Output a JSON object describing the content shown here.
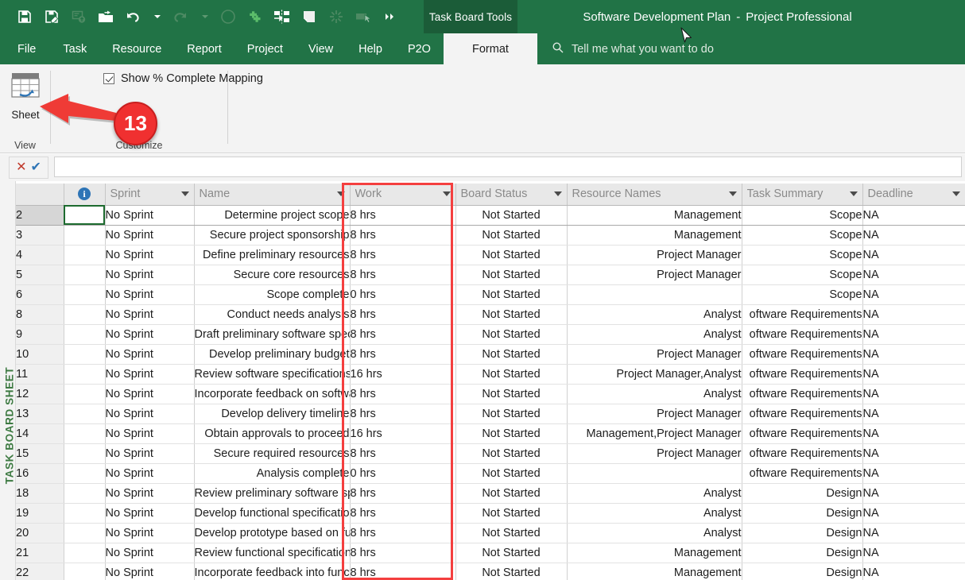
{
  "window": {
    "context_tab_group": "Task Board Tools",
    "document_title": "Software Development Plan",
    "title_separator": "-",
    "app_name": "Project Professional"
  },
  "quick_access": {
    "buttons": [
      {
        "name": "save-icon",
        "label": "Save",
        "enabled": true
      },
      {
        "name": "save-as-icon",
        "label": "Save As",
        "enabled": true
      },
      {
        "name": "publish-icon",
        "label": "Publish",
        "enabled": false
      },
      {
        "name": "open-icon",
        "label": "Open",
        "enabled": true
      },
      {
        "name": "undo-icon",
        "label": "Undo",
        "enabled": true
      },
      {
        "name": "redo-icon",
        "label": "Redo",
        "enabled": false
      },
      {
        "name": "circle-icon",
        "label": "Cycle",
        "enabled": false
      },
      {
        "name": "add-task-icon",
        "label": "Add Task",
        "enabled": true
      },
      {
        "name": "link-tasks-icon",
        "label": "Link Tasks",
        "enabled": true
      },
      {
        "name": "new-window-icon",
        "label": "New Window",
        "enabled": true
      },
      {
        "name": "unlink-tasks-icon",
        "label": "Unlink Tasks",
        "enabled": false
      },
      {
        "name": "inspect-task-icon",
        "label": "Inspect Task",
        "enabled": false
      },
      {
        "name": "more-commands-icon",
        "label": "More",
        "enabled": true
      }
    ]
  },
  "ribbon": {
    "tabs": [
      {
        "label": "File",
        "active": false
      },
      {
        "label": "Task",
        "active": false
      },
      {
        "label": "Resource",
        "active": false
      },
      {
        "label": "Report",
        "active": false
      },
      {
        "label": "Project",
        "active": false
      },
      {
        "label": "View",
        "active": false
      },
      {
        "label": "Help",
        "active": false
      },
      {
        "label": "P2O",
        "active": false
      }
    ],
    "contextual_tab": {
      "label": "Format",
      "active": true
    },
    "tell_me": {
      "placeholder": "Tell me what you want to do",
      "icon": "search-icon"
    },
    "groups": [
      {
        "label": "View",
        "buttons": [
          {
            "label": "Sheet",
            "icon": "sheet-view-icon"
          }
        ]
      },
      {
        "label": "Customize",
        "checkbox": {
          "label": "Show % Complete Mapping",
          "checked": true
        }
      }
    ]
  },
  "annotations": {
    "step_badge": "13",
    "arrow": "red-left-arrow",
    "highlight": "work-column-red-box"
  },
  "entry_bar": {
    "cancel_icon": "cancel-entry-icon",
    "confirm_icon": "confirm-entry-icon",
    "cancel_glyph": "✕",
    "confirm_glyph": "✔",
    "value": ""
  },
  "side_tab": {
    "label": "TASK BOARD SHEET",
    "color": "#3d7a42"
  },
  "grid": {
    "columns": [
      {
        "key": "rownum",
        "label": "",
        "align": "left",
        "caret": false
      },
      {
        "key": "info",
        "label": "",
        "align": "center",
        "caret": false,
        "icon": "info-icon"
      },
      {
        "key": "sprint",
        "label": "Sprint",
        "align": "left",
        "caret": true
      },
      {
        "key": "name",
        "label": "Name",
        "align": "left",
        "caret": true
      },
      {
        "key": "work",
        "label": "Work",
        "align": "left",
        "caret": true
      },
      {
        "key": "board_status",
        "label": "Board Status",
        "align": "left",
        "caret": true
      },
      {
        "key": "resource_names",
        "label": "Resource Names",
        "align": "left",
        "caret": true
      },
      {
        "key": "task_summary",
        "label": "Task Summary",
        "align": "left",
        "caret": true
      },
      {
        "key": "deadline",
        "label": "Deadline",
        "align": "left",
        "caret": true
      }
    ],
    "rows": [
      {
        "rownum": "2",
        "sprint": "No Sprint",
        "name": "Determine project scope",
        "work": "8 hrs",
        "board_status": "Not Started",
        "resource_names": "Management",
        "task_summary": "Scope",
        "deadline": "NA",
        "selected": true
      },
      {
        "rownum": "3",
        "sprint": "No Sprint",
        "name": "Secure project sponsorship",
        "work": "8 hrs",
        "board_status": "Not Started",
        "resource_names": "Management",
        "task_summary": "Scope",
        "deadline": "NA",
        "selected": false
      },
      {
        "rownum": "4",
        "sprint": "No Sprint",
        "name": "Define preliminary resources",
        "work": "8 hrs",
        "board_status": "Not Started",
        "resource_names": "Project Manager",
        "task_summary": "Scope",
        "deadline": "NA",
        "selected": false
      },
      {
        "rownum": "5",
        "sprint": "No Sprint",
        "name": "Secure core resources",
        "work": "8 hrs",
        "board_status": "Not Started",
        "resource_names": "Project Manager",
        "task_summary": "Scope",
        "deadline": "NA",
        "selected": false
      },
      {
        "rownum": "6",
        "sprint": "No Sprint",
        "name": "Scope complete",
        "work": "0 hrs",
        "board_status": "Not Started",
        "resource_names": "",
        "task_summary": "Scope",
        "deadline": "NA",
        "selected": false
      },
      {
        "rownum": "8",
        "sprint": "No Sprint",
        "name": "Conduct needs analysis",
        "work": "8 hrs",
        "board_status": "Not Started",
        "resource_names": "Analyst",
        "task_summary": "oftware Requirements",
        "deadline": "NA",
        "selected": false
      },
      {
        "rownum": "9",
        "sprint": "No Sprint",
        "name": "Draft preliminary software specifications",
        "work": "8 hrs",
        "board_status": "Not Started",
        "resource_names": "Analyst",
        "task_summary": "oftware Requirements",
        "deadline": "NA",
        "selected": false
      },
      {
        "rownum": "10",
        "sprint": "No Sprint",
        "name": "Develop preliminary budget",
        "work": "8 hrs",
        "board_status": "Not Started",
        "resource_names": "Project Manager",
        "task_summary": "oftware Requirements",
        "deadline": "NA",
        "selected": false
      },
      {
        "rownum": "11",
        "sprint": "No Sprint",
        "name": "Review software specifications/budget with team",
        "work": "16 hrs",
        "board_status": "Not Started",
        "resource_names": "Project Manager,Analyst",
        "task_summary": "oftware Requirements",
        "deadline": "NA",
        "selected": false
      },
      {
        "rownum": "12",
        "sprint": "No Sprint",
        "name": "Incorporate feedback on software specifications",
        "work": "8 hrs",
        "board_status": "Not Started",
        "resource_names": "Analyst",
        "task_summary": "oftware Requirements",
        "deadline": "NA",
        "selected": false
      },
      {
        "rownum": "13",
        "sprint": "No Sprint",
        "name": "Develop delivery timeline",
        "work": "8 hrs",
        "board_status": "Not Started",
        "resource_names": "Project Manager",
        "task_summary": "oftware Requirements",
        "deadline": "NA",
        "selected": false
      },
      {
        "rownum": "14",
        "sprint": "No Sprint",
        "name": "Obtain approvals to proceed",
        "work": "16 hrs",
        "board_status": "Not Started",
        "resource_names": "Management,Project Manager",
        "task_summary": "oftware Requirements",
        "deadline": "NA",
        "selected": false
      },
      {
        "rownum": "15",
        "sprint": "No Sprint",
        "name": "Secure required resources",
        "work": "8 hrs",
        "board_status": "Not Started",
        "resource_names": "Project Manager",
        "task_summary": "oftware Requirements",
        "deadline": "NA",
        "selected": false
      },
      {
        "rownum": "16",
        "sprint": "No Sprint",
        "name": "Analysis complete",
        "work": "0 hrs",
        "board_status": "Not Started",
        "resource_names": "",
        "task_summary": "oftware Requirements",
        "deadline": "NA",
        "selected": false
      },
      {
        "rownum": "18",
        "sprint": "No Sprint",
        "name": "Review preliminary software specifications",
        "work": "8 hrs",
        "board_status": "Not Started",
        "resource_names": "Analyst",
        "task_summary": "Design",
        "deadline": "NA",
        "selected": false
      },
      {
        "rownum": "19",
        "sprint": "No Sprint",
        "name": "Develop functional specifications",
        "work": "8 hrs",
        "board_status": "Not Started",
        "resource_names": "Analyst",
        "task_summary": "Design",
        "deadline": "NA",
        "selected": false
      },
      {
        "rownum": "20",
        "sprint": "No Sprint",
        "name": "Develop prototype based on functional specifications",
        "work": "8 hrs",
        "board_status": "Not Started",
        "resource_names": "Analyst",
        "task_summary": "Design",
        "deadline": "NA",
        "selected": false
      },
      {
        "rownum": "21",
        "sprint": "No Sprint",
        "name": "Review functional specifications",
        "work": "8 hrs",
        "board_status": "Not Started",
        "resource_names": "Management",
        "task_summary": "Design",
        "deadline": "NA",
        "selected": false
      },
      {
        "rownum": "22",
        "sprint": "No Sprint",
        "name": "Incorporate feedback into functional specifications",
        "work": "8 hrs",
        "board_status": "Not Started",
        "resource_names": "Management",
        "task_summary": "Design",
        "deadline": "NA",
        "selected": false
      }
    ]
  },
  "colors": {
    "ribbon_green": "#217346",
    "ribbon_green_dark": "#1b5c38",
    "annotation_red": "#f43f3f",
    "badge_red": "#f03030",
    "side_tab_green": "#3d7a42",
    "selection_green": "#1d6b2f",
    "info_blue": "#2e75b6"
  }
}
